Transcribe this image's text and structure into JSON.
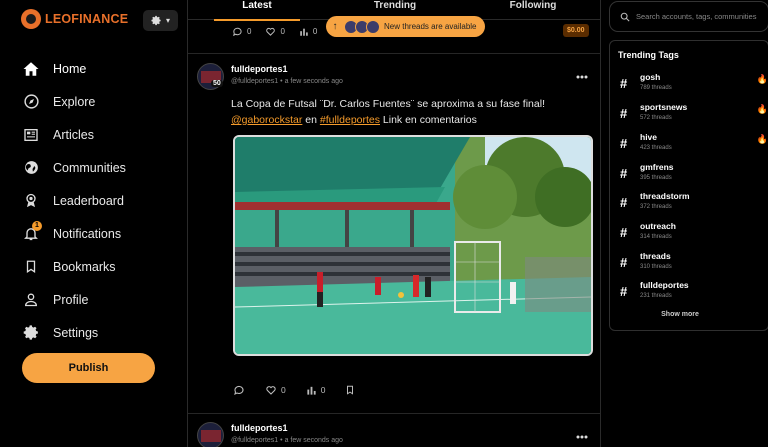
{
  "brand": {
    "name": "LEOFINANCE",
    "color": "#e8702a"
  },
  "settings_button": {
    "icon": "gear-icon",
    "caret": "▾"
  },
  "nav": {
    "items": [
      {
        "label": "Home",
        "icon": "home-icon"
      },
      {
        "label": "Explore",
        "icon": "compass-icon"
      },
      {
        "label": "Articles",
        "icon": "newspaper-icon"
      },
      {
        "label": "Communities",
        "icon": "globe-icon"
      },
      {
        "label": "Leaderboard",
        "icon": "medal-icon"
      },
      {
        "label": "Notifications",
        "icon": "bell-icon",
        "badge": "1"
      },
      {
        "label": "Bookmarks",
        "icon": "bookmark-icon"
      },
      {
        "label": "Profile",
        "icon": "user-icon"
      },
      {
        "label": "Settings",
        "icon": "gear-icon"
      }
    ],
    "active": "Home"
  },
  "publish_label": "Publish",
  "feed": {
    "tabs": [
      {
        "label": "Latest"
      },
      {
        "label": "Trending"
      },
      {
        "label": "Following"
      }
    ],
    "active_tab": "Latest",
    "new_threads": {
      "label": "New threads are available",
      "arrow": "↑"
    },
    "previous_post": {
      "comments": "0",
      "likes": "0",
      "views": "0",
      "amount": "$0.00"
    },
    "post": {
      "author": "fulldeportes1",
      "handle": "@fulldeportes1",
      "time": "a few seconds ago",
      "reputation": "50",
      "text_line1": "La Copa de Futsal ¨Dr. Carlos Fuentes¨ se aproxima a su fase final!",
      "mention_user": "@gaborockstar",
      "text_mid": " en ",
      "mention_tag": "#fulldeportes",
      "text_end": " Link en comentarios",
      "likes": "0",
      "views": "0"
    },
    "next_post": {
      "author": "fulldeportes1",
      "handle": "@fulldeportes1",
      "time": "a few seconds ago",
      "reputation": "50"
    }
  },
  "search": {
    "placeholder": "Search accounts, tags, communities"
  },
  "trending": {
    "title": "Trending Tags",
    "tags": [
      {
        "name": "gosh",
        "count": "789 threads",
        "hot": true
      },
      {
        "name": "sportsnews",
        "count": "572 threads",
        "hot": true
      },
      {
        "name": "hive",
        "count": "423 threads",
        "hot": true
      },
      {
        "name": "gmfrens",
        "count": "395 threads",
        "hot": false
      },
      {
        "name": "threadstorm",
        "count": "372 threads",
        "hot": false
      },
      {
        "name": "outreach",
        "count": "314 threads",
        "hot": false
      },
      {
        "name": "threads",
        "count": "310 threads",
        "hot": false
      },
      {
        "name": "fulldeportes",
        "count": "231 threads",
        "hot": false
      }
    ],
    "show_more": "Show more"
  },
  "colors": {
    "accent": "#f7a443",
    "background": "#000000"
  }
}
